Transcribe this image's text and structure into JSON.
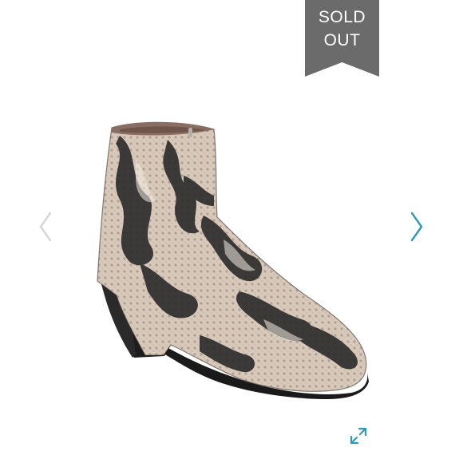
{
  "badge": {
    "line1": "SOLD",
    "line2": "OUT",
    "color": "#6b6b6b"
  },
  "product": {
    "image_subject": "snakeskin-ankle-boot",
    "pattern": "snakeskin"
  },
  "controls": {
    "prev_icon": "chevron-left-icon",
    "next_icon": "chevron-right-icon",
    "expand_icon": "expand-arrows-icon"
  },
  "colors": {
    "prev_arrow": "#d6d6d6",
    "next_arrow": "#2e9bb6",
    "expand": "#2e9bb6",
    "boot_base": "#d9c9ba",
    "boot_pattern": "#2b2b2b",
    "heel": "#1c1c1c"
  }
}
